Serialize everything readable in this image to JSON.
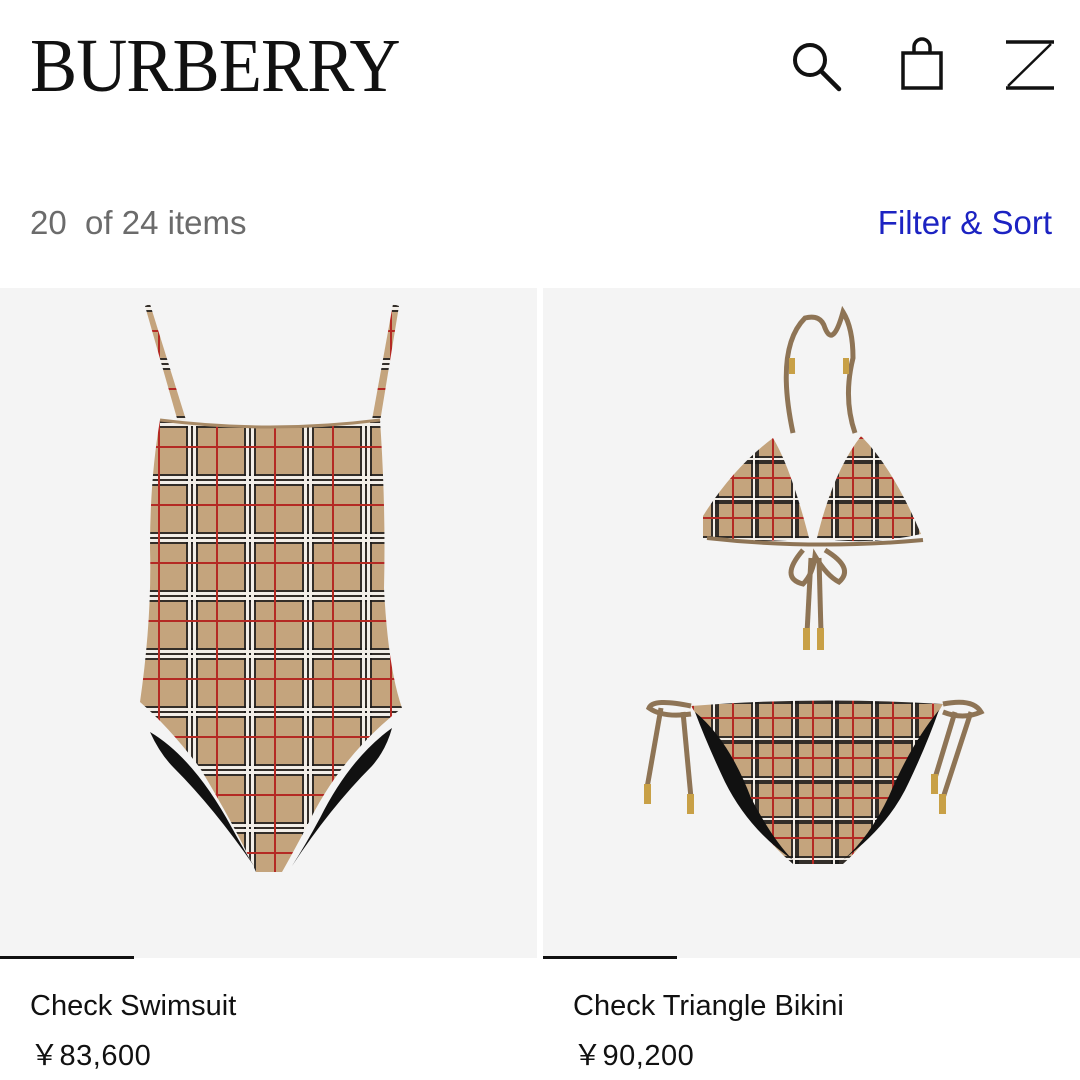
{
  "header": {
    "brand": "BURBERRY",
    "icons": [
      "search-icon",
      "shopping-bag-icon",
      "menu-icon"
    ]
  },
  "listing": {
    "count": "20  of 24 items",
    "filter_label": "Filter & Sort"
  },
  "products": [
    {
      "name": "Check Swimsuit",
      "price": "￥83,600",
      "image_progress": 0.25
    },
    {
      "name": "Check Triangle Bikini",
      "price": "￥90,200",
      "image_progress": 0.25
    }
  ],
  "colors": {
    "link": "#1c23c2",
    "text": "#111111",
    "muted": "#6b6b6b",
    "check_beige": "#c4a47d",
    "check_black": "#1a1a1a",
    "check_red": "#b42a24",
    "check_white": "#f2eee8"
  }
}
